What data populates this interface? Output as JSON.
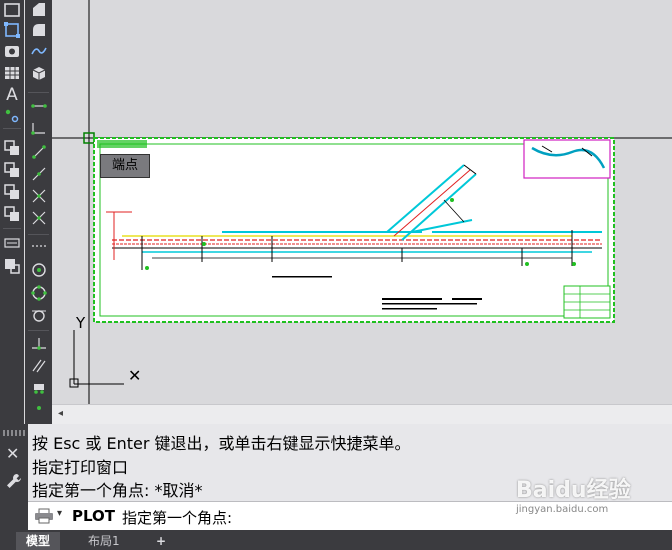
{
  "drawing": {
    "tooltip": "端点"
  },
  "axes": {
    "y_label": "Y",
    "x_label": "✕"
  },
  "command": {
    "line1": "按 Esc 或 Enter 键退出，或单击右键显示快捷菜单。",
    "line2": "指定打印窗口",
    "line3": "指定第一个角点: *取消*",
    "current_command": "PLOT",
    "current_prompt": "指定第一个角点:"
  },
  "tabs": {
    "model": "模型",
    "layout1": "布局1",
    "add": "+"
  },
  "side_icons": {
    "close": "✕",
    "wrench": "wrench-icon"
  },
  "toolbar_text_icon": "A",
  "watermark": {
    "text": "Baidu经验",
    "sub": "jingyan.baidu.com"
  },
  "colors": {
    "toolbar_bg": "#3b3b3f",
    "canvas_bg": "#d9d9dc",
    "frame_green": "#20c020",
    "cyan": "#00c8d8",
    "red": "#e02020",
    "yellow": "#e8e020",
    "magenta": "#d020c0"
  }
}
